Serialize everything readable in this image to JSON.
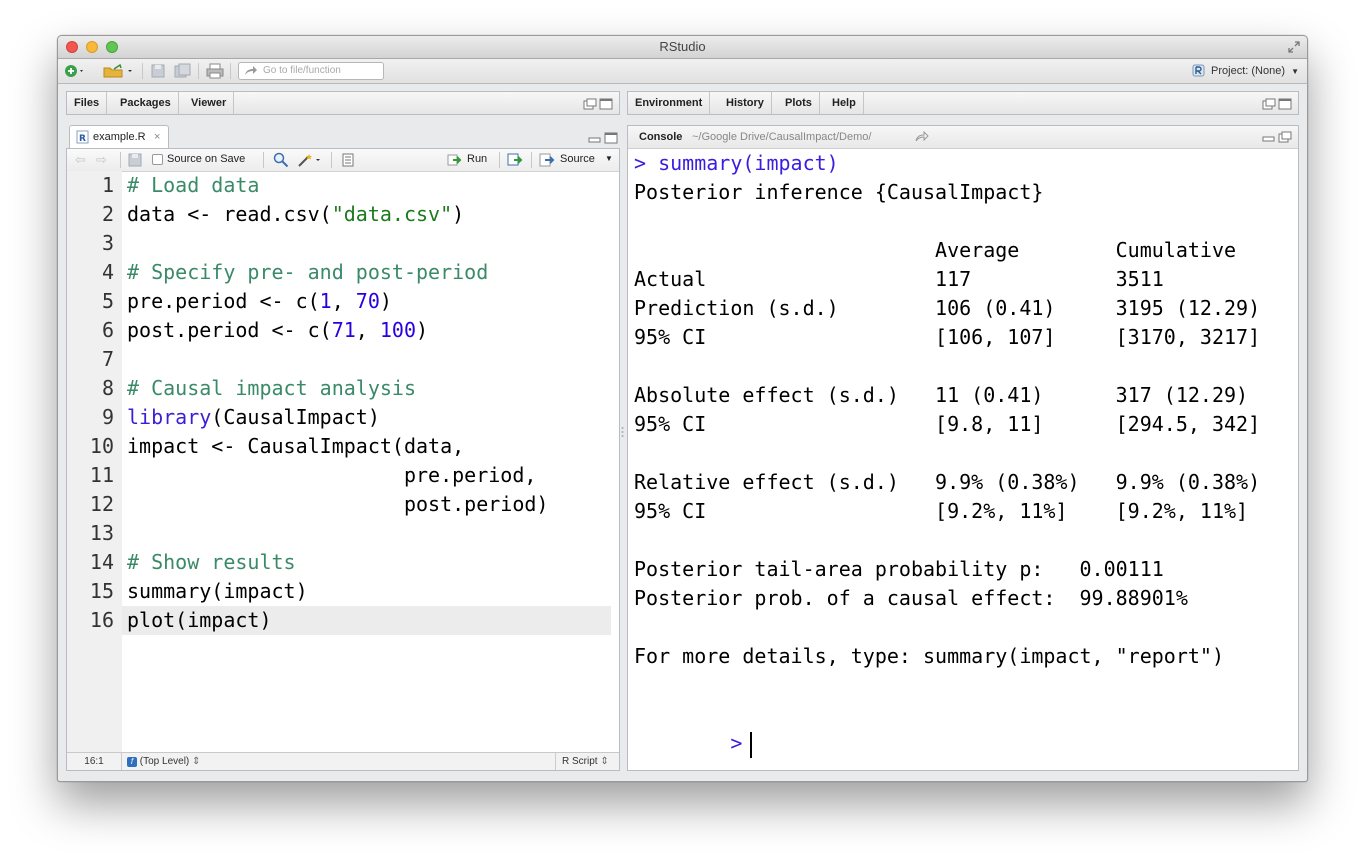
{
  "app": {
    "title": "RStudio"
  },
  "toolbar": {
    "goto_placeholder": "Go to file/function",
    "project_label": "Project: (None)"
  },
  "left_top_tabs": [
    "Files",
    "Packages",
    "Viewer"
  ],
  "right_top_tabs": [
    "Environment",
    "History",
    "Plots",
    "Help"
  ],
  "editor": {
    "tab_name": "example.R",
    "source_on_save": "Source on Save",
    "run_label": "Run",
    "source_label": "Source",
    "line_numbers": [
      "1",
      "2",
      "3",
      "4",
      "5",
      "6",
      "7",
      "8",
      "9",
      "10",
      "11",
      "12",
      "13",
      "14",
      "15",
      "16"
    ],
    "lines": [
      {
        "segments": [
          {
            "t": "# Load data",
            "c": "cm"
          }
        ]
      },
      {
        "segments": [
          {
            "t": "data <- read.csv(",
            "c": ""
          },
          {
            "t": "\"data.csv\"",
            "c": "str"
          },
          {
            "t": ")",
            "c": ""
          }
        ]
      },
      {
        "segments": []
      },
      {
        "segments": [
          {
            "t": "# Specify pre- and post-period",
            "c": "cm"
          }
        ]
      },
      {
        "segments": [
          {
            "t": "pre.period <- c(",
            "c": ""
          },
          {
            "t": "1",
            "c": "num"
          },
          {
            "t": ", ",
            "c": ""
          },
          {
            "t": "70",
            "c": "num"
          },
          {
            "t": ")",
            "c": ""
          }
        ]
      },
      {
        "segments": [
          {
            "t": "post.period <- c(",
            "c": ""
          },
          {
            "t": "71",
            "c": "num"
          },
          {
            "t": ", ",
            "c": ""
          },
          {
            "t": "100",
            "c": "num"
          },
          {
            "t": ")",
            "c": ""
          }
        ]
      },
      {
        "segments": []
      },
      {
        "segments": [
          {
            "t": "# Causal impact analysis",
            "c": "cm"
          }
        ]
      },
      {
        "segments": [
          {
            "t": "library",
            "c": "kw"
          },
          {
            "t": "(CausalImpact)",
            "c": ""
          }
        ]
      },
      {
        "segments": [
          {
            "t": "impact <- CausalImpact(data,",
            "c": ""
          }
        ]
      },
      {
        "segments": [
          {
            "t": "                       pre.period,",
            "c": ""
          }
        ]
      },
      {
        "segments": [
          {
            "t": "                       post.period)",
            "c": ""
          }
        ]
      },
      {
        "segments": []
      },
      {
        "segments": [
          {
            "t": "# Show results",
            "c": "cm"
          }
        ]
      },
      {
        "segments": [
          {
            "t": "summary(impact)",
            "c": ""
          }
        ]
      },
      {
        "segments": [
          {
            "t": "plot(impact)",
            "c": ""
          }
        ]
      }
    ],
    "status_position": "16:1",
    "status_scope": "(Top Level)",
    "status_filetype": "R Script"
  },
  "console": {
    "tab_label": "Console",
    "path": "~/Google Drive/CausalImpact/Demo/",
    "command": "> summary(impact)",
    "output": [
      "Posterior inference {CausalImpact}",
      "",
      "                         Average        Cumulative",
      "Actual                   117            3511",
      "Prediction (s.d.)        106 (0.41)     3195 (12.29)",
      "95% CI                   [106, 107]     [3170, 3217]",
      "",
      "Absolute effect (s.d.)   11 (0.41)      317 (12.29)",
      "95% CI                   [9.8, 11]      [294.5, 342]",
      "",
      "Relative effect (s.d.)   9.9% (0.38%)   9.9% (0.38%)",
      "95% CI                   [9.2%, 11%]    [9.2%, 11%]",
      "",
      "Posterior tail-area probability p:   0.00111",
      "Posterior prob. of a causal effect:  99.88901%",
      "",
      "For more details, type: summary(impact, \"report\")",
      ""
    ],
    "prompt": ">"
  }
}
